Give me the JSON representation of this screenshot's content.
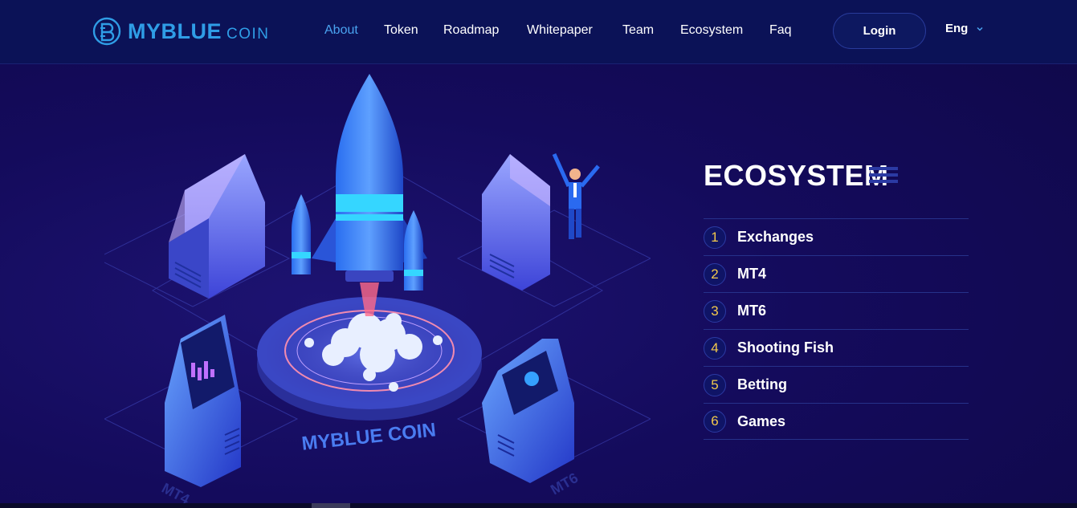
{
  "brand": {
    "name_primary": "MYBLUE",
    "name_secondary": "COIN",
    "logo_icon": "myblue-coin-logo-icon",
    "color": "#2f9de6"
  },
  "nav": {
    "items": [
      {
        "label": "About",
        "active": true
      },
      {
        "label": "Token",
        "active": false
      },
      {
        "label": "Roadmap",
        "active": false
      },
      {
        "label": "Whitepaper",
        "active": false
      },
      {
        "label": "Team",
        "active": false
      },
      {
        "label": "Ecosystem",
        "active": false
      },
      {
        "label": "Faq",
        "active": false
      }
    ],
    "login_label": "Login",
    "language": "Eng",
    "language_icon": "chevron-down-icon"
  },
  "illustration": {
    "platform_text": "MYBLUE COIN",
    "left_terminal_text": "MT4",
    "right_terminal_text": "MT6"
  },
  "ecosystem": {
    "title": "ECOSYSTEM",
    "items": [
      {
        "number": "1",
        "label": "Exchanges"
      },
      {
        "number": "2",
        "label": "MT4"
      },
      {
        "number": "3",
        "label": "MT6"
      },
      {
        "number": "4",
        "label": "Shooting Fish"
      },
      {
        "number": "5",
        "label": "Betting"
      },
      {
        "number": "6",
        "label": "Games"
      }
    ]
  },
  "colors": {
    "background": "#140b5c",
    "header": "#0b1257",
    "accent_blue": "#4aa3f0",
    "number_gold": "#f2c94c"
  }
}
